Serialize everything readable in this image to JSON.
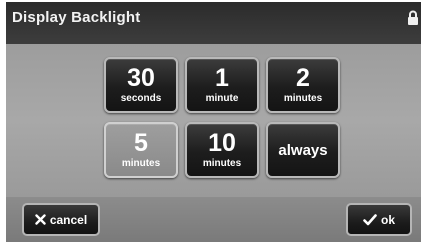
{
  "title": "Display Backlight",
  "icons": {
    "lock": "lock-icon",
    "cancel": "x-icon",
    "ok": "check-icon"
  },
  "options": [
    {
      "value": "30",
      "unit": "seconds",
      "selected": false
    },
    {
      "value": "1",
      "unit": "minute",
      "selected": false
    },
    {
      "value": "2",
      "unit": "minutes",
      "selected": false
    },
    {
      "value": "5",
      "unit": "minutes",
      "selected": true
    },
    {
      "value": "10",
      "unit": "minutes",
      "selected": false
    },
    {
      "value": "always",
      "unit": "",
      "selected": false
    }
  ],
  "buttons": {
    "cancel": "cancel",
    "ok": "ok"
  }
}
